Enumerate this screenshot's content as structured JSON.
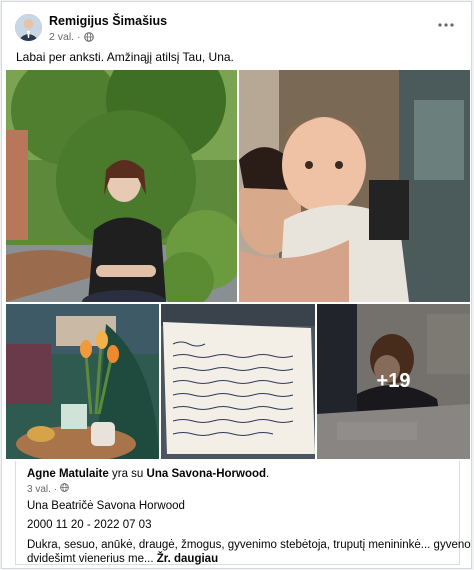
{
  "post": {
    "author": "Remigijus Šimašius",
    "time": "2 val. ·",
    "text": "Labai per anksti. Amžinąjį atilsį Tau, Una.",
    "more_icon": "more-horizontal-icon",
    "audience_icon": "globe-icon"
  },
  "photos": {
    "more_count": "+19"
  },
  "shared": {
    "author": "Agne Matulaite",
    "with_text": "yra su",
    "tagged": "Una Savona-Horwood",
    "time": "3 val. ·",
    "name": "Una Beatričė Savona Horwood",
    "dates": "2000 11 20 - 2022 07 03",
    "description_line1": "Dukra, sesuo, anūkė, draugė, žmogus, gyvenimo stebėtoja, truputį menininkė... gyveno",
    "description_line2": "dvidešimt vienerius me...",
    "see_more": "Žr. daugiau"
  },
  "colors": {
    "text_primary": "#050505",
    "text_secondary": "#65676b",
    "card_bg": "#ffffff",
    "page_bg": "#f0f2f5"
  }
}
